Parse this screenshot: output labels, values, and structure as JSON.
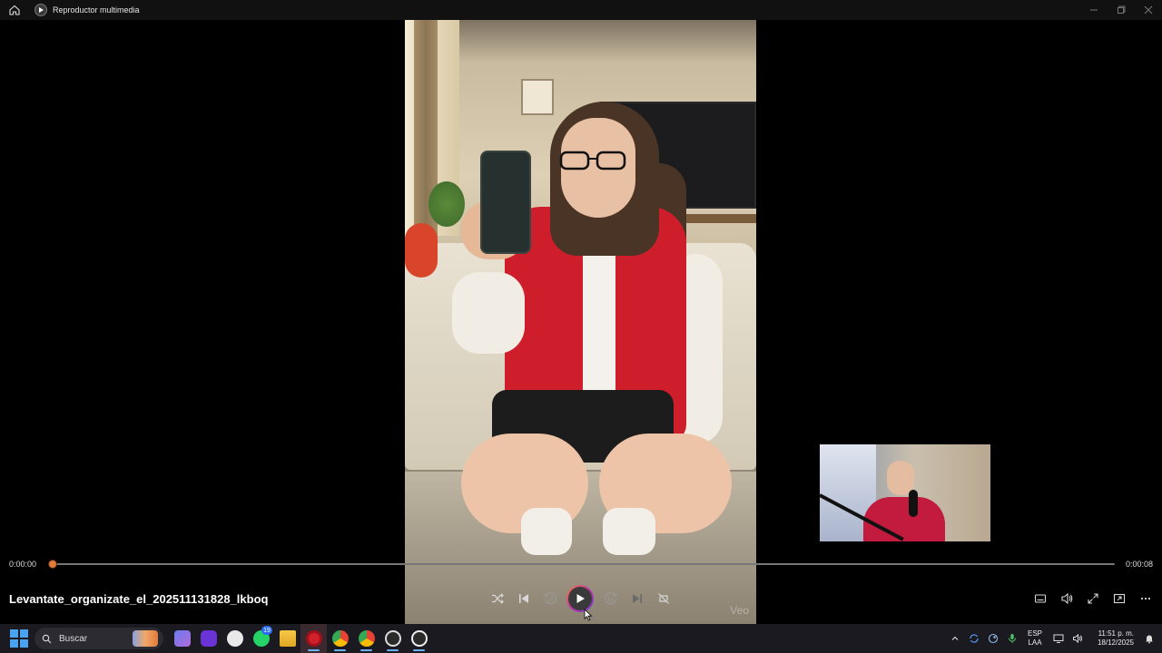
{
  "window": {
    "title": "Reproductor multimedia",
    "controls": [
      "minimize",
      "maximize",
      "close"
    ]
  },
  "video": {
    "watermark": "Veo"
  },
  "playback": {
    "current_time": "0:00:00",
    "total_time": "0:00:08",
    "progress": 0,
    "file_name": "Levantate_organizate_el_202511131828_lkboq",
    "accent_color": "#e07b3c"
  },
  "controls": {
    "center": [
      "shuffle-icon",
      "previous-icon",
      "rewind-10-icon",
      "play-icon",
      "forward-30-icon",
      "next-icon",
      "repeat-off-icon"
    ],
    "rewind_label": "10",
    "forward_label": "30",
    "right": [
      "subtitles-icon",
      "volume-icon",
      "fullscreen-icon",
      "miniplayer-icon",
      "more-icon"
    ]
  },
  "taskbar": {
    "search_placeholder": "Buscar",
    "whatsapp_badge": "19",
    "apps": [
      "copilot-icon",
      "twitch-app-icon",
      "clipchamp-icon",
      "whatsapp-icon",
      "file-explorer-icon",
      "opera-icon",
      "chrome-icon",
      "chrome-profile-icon",
      "obs-icon",
      "media-player-icon"
    ]
  },
  "tray": {
    "language": "ESP",
    "layout": "LAA",
    "time": "11:51 p. m.",
    "date": "18/12/2025"
  }
}
